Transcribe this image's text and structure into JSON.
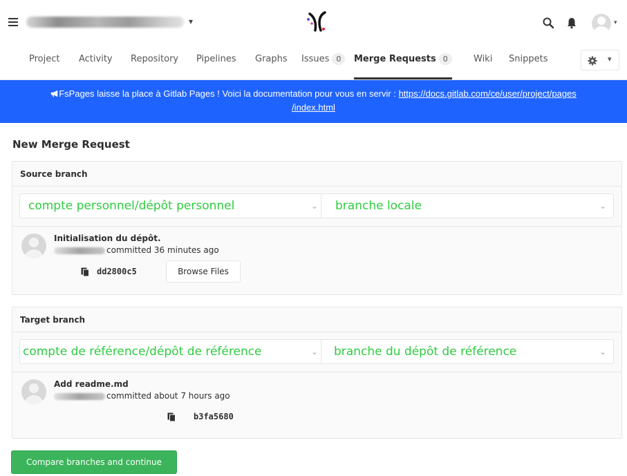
{
  "header": {
    "project_caret": "▾",
    "avatar_caret": "▾"
  },
  "nav": {
    "tabs": [
      {
        "label": "Project"
      },
      {
        "label": "Activity"
      },
      {
        "label": "Repository"
      },
      {
        "label": "Pipelines"
      },
      {
        "label": "Graphs"
      },
      {
        "label": "Issues",
        "count": "0"
      },
      {
        "label": "Merge Requests",
        "count": "0",
        "active": true
      },
      {
        "label": "Wiki"
      },
      {
        "label": "Snippets"
      }
    ],
    "settings_caret": "▾"
  },
  "banner": {
    "text": "FsPages laisse la place à Gitlab Pages ! Voici la documentation pour vous en servir : ",
    "link_part1": "https://docs.gitlab.com/ce/user/project/pages",
    "link_part2": "/index.html",
    "bg_color": "#1f63ff"
  },
  "page": {
    "title": "New Merge Request"
  },
  "source": {
    "heading": "Source branch",
    "project_select": "compte personnel/dépôt personnel",
    "branch_select": "branche locale",
    "commit_title": "Initialisation du dépôt.",
    "commit_meta": "committed 36 minutes ago",
    "sha": "dd2800c5",
    "browse_label": "Browse Files"
  },
  "target": {
    "heading": "Target branch",
    "project_select": "compte de référence/dépôt de référence",
    "branch_select": "branche du dépôt de référence",
    "commit_title": "Add readme.md",
    "commit_meta": "committed about 7 hours ago",
    "sha": "b3fa5680"
  },
  "actions": {
    "submit_label": "Compare branches and continue",
    "submit_color": "#3cb45b"
  },
  "select_text_color": "#2ecc40"
}
